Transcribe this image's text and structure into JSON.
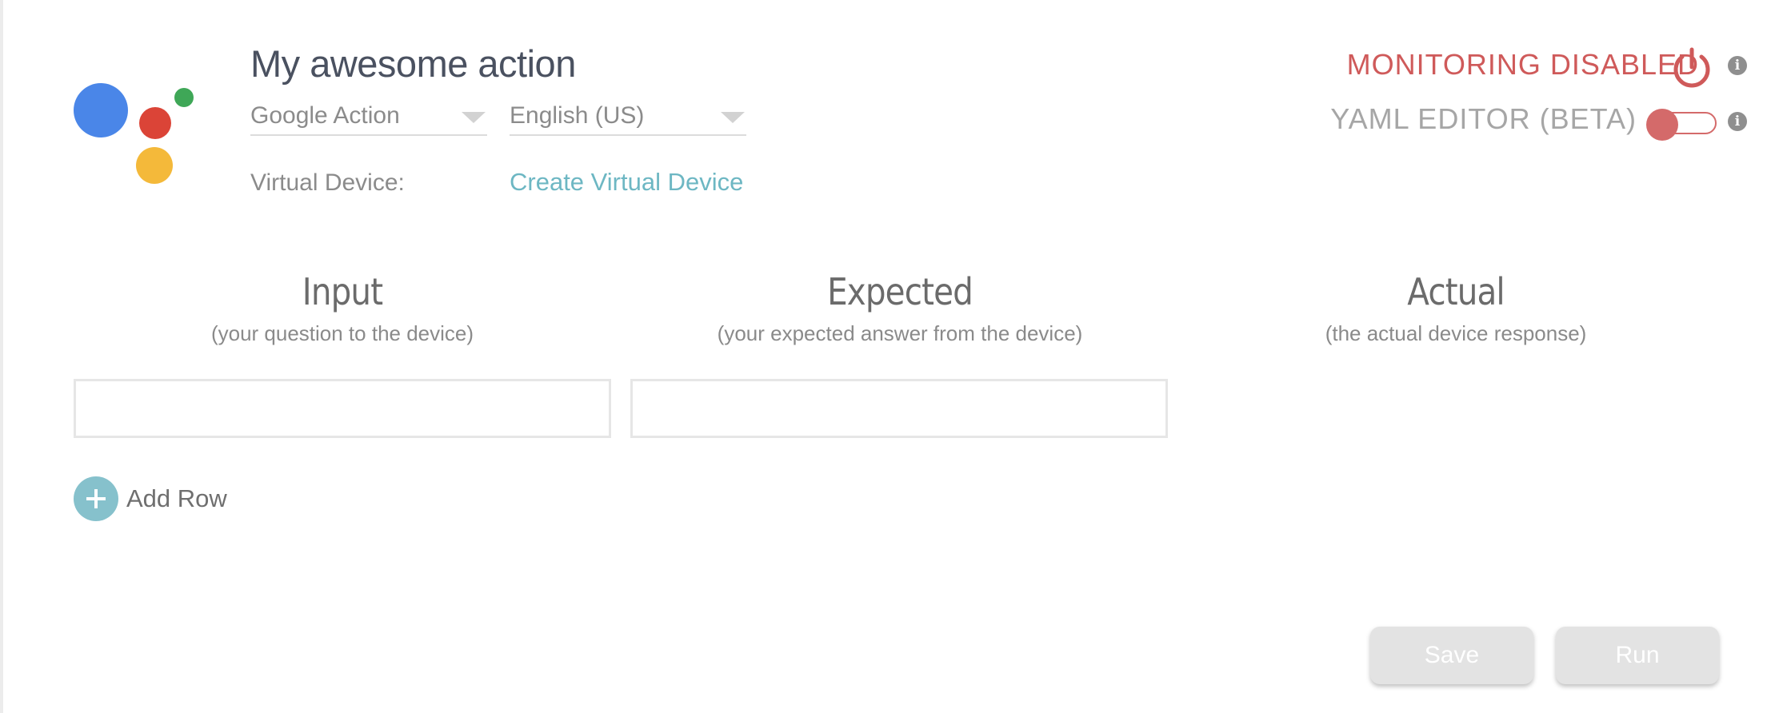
{
  "header": {
    "title": "My awesome action",
    "platform_select": "Google Action",
    "locale_select": "English (US)",
    "virtual_device_label": "Virtual Device:",
    "virtual_device_link": "Create Virtual Device",
    "monitoring_status": "MONITORING DISABLED",
    "yaml_editor_label": "YAML EDITOR (BETA)",
    "yaml_editor_enabled": false,
    "info_glyph": "i"
  },
  "logo": {
    "dot_colors": {
      "blue": "#4a86e8",
      "red": "#db4437",
      "green": "#3fa757",
      "yellow": "#f4b93a"
    }
  },
  "columns": [
    {
      "title": "Input",
      "subtitle": "(your question to the device)"
    },
    {
      "title": "Expected",
      "subtitle": "(your expected answer from the device)"
    },
    {
      "title": "Actual",
      "subtitle": "(the actual device response)"
    }
  ],
  "rows": [
    {
      "input": "",
      "expected": "",
      "actual": ""
    }
  ],
  "add_row_label": "Add Row",
  "actions": {
    "save_label": "Save",
    "run_label": "Run"
  },
  "colors": {
    "accent": "#6db7c3",
    "danger": "#cf5a5a",
    "button_disabled": "#e3e3e3"
  },
  "icons": [
    "power-icon",
    "info-icon",
    "plus-icon",
    "chevron-down-icon"
  ]
}
